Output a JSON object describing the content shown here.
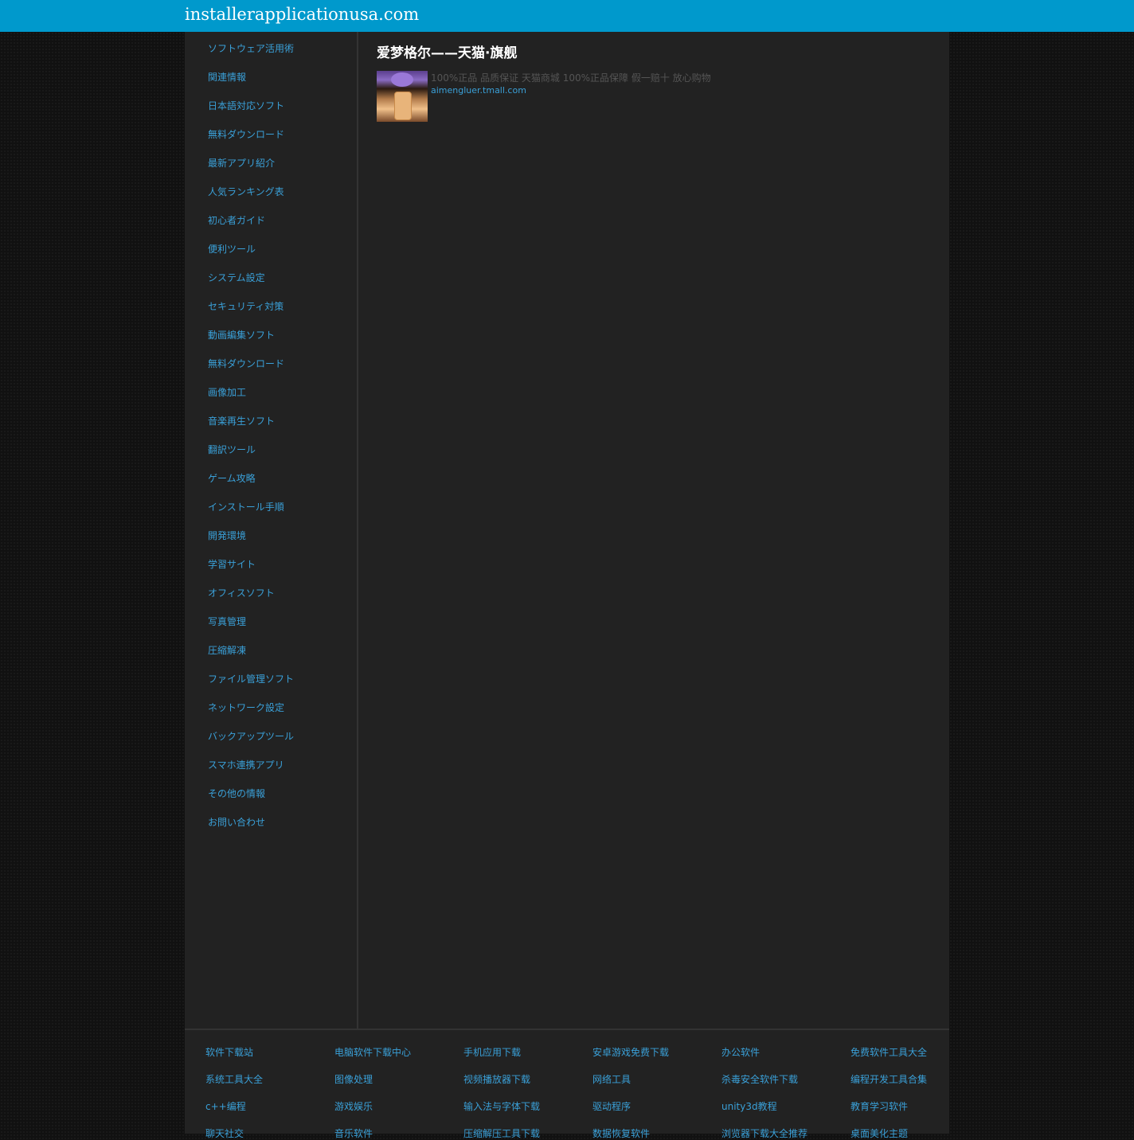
{
  "header": {
    "site_title": "installerapplicationusa.com"
  },
  "sidebar": {
    "items": [
      {
        "label": "ソフトウェア活用術"
      },
      {
        "label": "関連情報"
      },
      {
        "label": "日本語対応ソフト"
      },
      {
        "label": "無料ダウンロード"
      },
      {
        "label": "最新アプリ紹介"
      },
      {
        "label": "人気ランキング表"
      },
      {
        "label": "初心者ガイド"
      },
      {
        "label": "便利ツール"
      },
      {
        "label": "システム設定"
      },
      {
        "label": "セキュリティ対策"
      },
      {
        "label": "動画編集ソフト"
      },
      {
        "label": "無料ダウンロード"
      },
      {
        "label": "画像加工"
      },
      {
        "label": "音楽再生ソフト"
      },
      {
        "label": "翻訳ツール"
      },
      {
        "label": "ゲーム攻略"
      },
      {
        "label": "インストール手順"
      },
      {
        "label": "開発環境"
      },
      {
        "label": "学習サイト"
      },
      {
        "label": "オフィスソフト"
      },
      {
        "label": "写真管理"
      },
      {
        "label": "圧縮解凍"
      },
      {
        "label": "ファイル管理ソフト"
      },
      {
        "label": "ネットワーク設定"
      },
      {
        "label": "バックアップツール"
      },
      {
        "label": "スマホ連携アプリ"
      },
      {
        "label": "その他の情報"
      },
      {
        "label": "お問い合わせ"
      }
    ]
  },
  "main": {
    "title": "爱梦格尔——天猫·旗舰",
    "ad": {
      "description": "100%正品 品质保证 天猫商城 100%正品保障 假一赔十 放心购物",
      "link": "aimengluer.tmall.com"
    }
  },
  "footer": {
    "links": [
      {
        "label": "软件下载站"
      },
      {
        "label": "电脑软件下载中心"
      },
      {
        "label": "手机应用下载"
      },
      {
        "label": "安卓游戏免费下载"
      },
      {
        "label": "办公软件"
      },
      {
        "label": "免费软件工具大全"
      },
      {
        "label": "系统工具大全"
      },
      {
        "label": "图像处理"
      },
      {
        "label": "视频播放器下载"
      },
      {
        "label": "网络工具"
      },
      {
        "label": "杀毒安全软件下载"
      },
      {
        "label": "编程开发工具合集"
      },
      {
        "label": "c++编程"
      },
      {
        "label": "游戏娱乐"
      },
      {
        "label": "输入法与字体下载"
      },
      {
        "label": "驱动程序"
      },
      {
        "label": "unity3d教程"
      },
      {
        "label": "教育学习软件"
      },
      {
        "label": "聊天社交"
      },
      {
        "label": "音乐软件"
      },
      {
        "label": "压缩解压工具下载"
      },
      {
        "label": "数据恢复软件"
      },
      {
        "label": "浏览器下载大全推荐"
      },
      {
        "label": "桌面美化主题"
      }
    ]
  }
}
